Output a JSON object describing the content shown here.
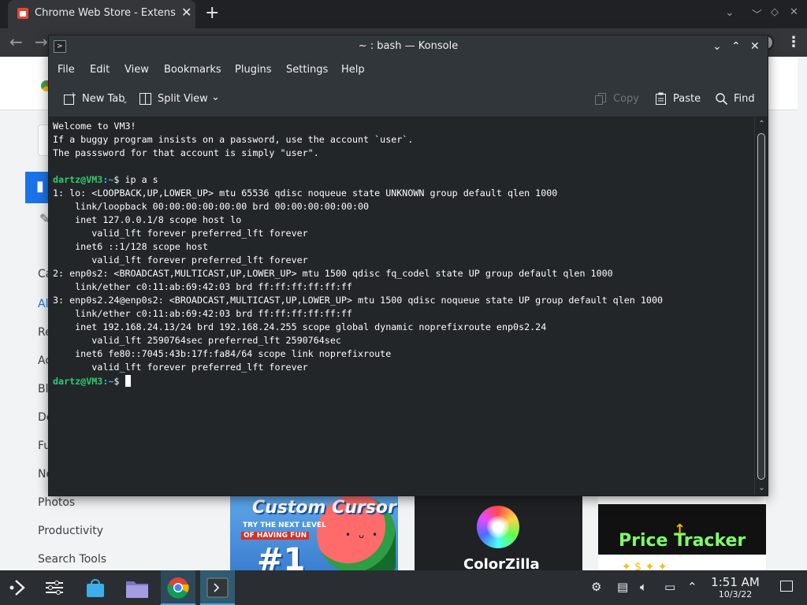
{
  "browser": {
    "tab_title": "Chrome Web Store - Extensions",
    "tab_close": "✕",
    "new_tab": "+"
  },
  "store": {
    "categories_partial": [
      "Ca",
      "All",
      "Re",
      "Ac",
      "Blo",
      "De",
      "Fu",
      "Ne"
    ],
    "categories_full": [
      "Photos",
      "Productivity",
      "Search Tools"
    ],
    "cards": [
      {
        "title": "Custom Cursor",
        "sub1": "TRY THE NEXT LEVEL",
        "sub2": "OF HAVING FUN",
        "badge": "#1"
      },
      {
        "title": "ColorZilla"
      },
      {
        "title": "Price Tracker"
      }
    ]
  },
  "konsole": {
    "title": "~ : bash — Konsole",
    "menu": [
      "File",
      "Edit",
      "View",
      "Bookmarks",
      "Plugins",
      "Settings",
      "Help"
    ],
    "toolbar": {
      "new_tab": "New Tab",
      "split_view": "Split View",
      "copy": "Copy",
      "paste": "Paste",
      "find": "Find"
    },
    "prompt_user": "dartz@VM3",
    "prompt_path": ":~",
    "prompt_symbol": "$ ",
    "command": "ip a s",
    "welcome": [
      "Welcome to VM3!",
      "If a buggy program insists on a password, use the account `user`.",
      "The passsword for that account is simply \"user\"."
    ],
    "output": [
      "1: lo: <LOOPBACK,UP,LOWER_UP> mtu 65536 qdisc noqueue state UNKNOWN group default qlen 1000",
      "    link/loopback 00:00:00:00:00:00 brd 00:00:00:00:00:00",
      "    inet 127.0.0.1/8 scope host lo",
      "       valid_lft forever preferred_lft forever",
      "    inet6 ::1/128 scope host",
      "       valid_lft forever preferred_lft forever",
      "2: enp0s2: <BROADCAST,MULTICAST,UP,LOWER_UP> mtu 1500 qdisc fq_codel state UP group default qlen 1000",
      "    link/ether c0:11:ab:69:42:03 brd ff:ff:ff:ff:ff:ff",
      "3: enp0s2.24@enp0s2: <BROADCAST,MULTICAST,UP,LOWER_UP> mtu 1500 qdisc noqueue state UP group default qlen 1000",
      "    link/ether c0:11:ab:69:42:03 brd ff:ff:ff:ff:ff:ff",
      "    inet 192.168.24.13/24 brd 192.168.24.255 scope global dynamic noprefixroute enp0s2.24",
      "       valid_lft 2590764sec preferred_lft 2590764sec",
      "    inet6 fe80::7045:43b:17f:fa84/64 scope link noprefixroute",
      "       valid_lft forever preferred_lft forever"
    ]
  },
  "taskbar": {
    "time": "1:51 AM",
    "date": "10/3/22"
  },
  "colors": {
    "terminal_bg": "#232629",
    "prompt_user": "#2ecc71",
    "prompt_path": "#3daee9",
    "accent": "#3daee9"
  }
}
